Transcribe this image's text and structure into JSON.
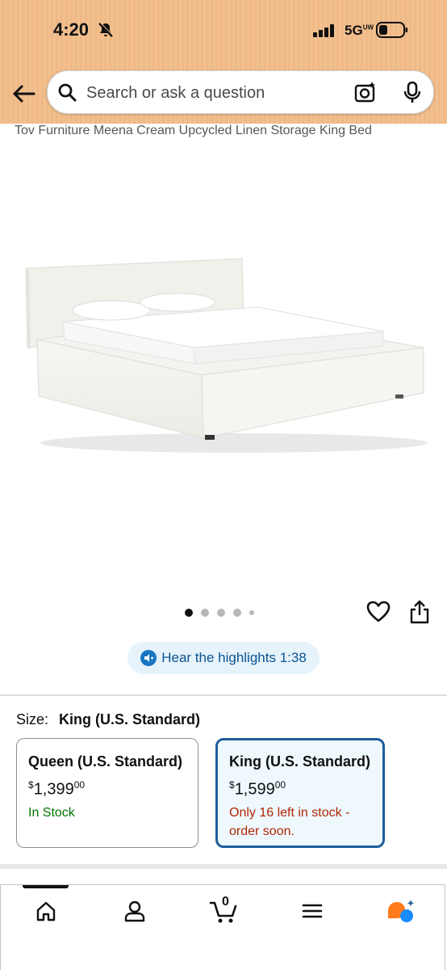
{
  "status_bar": {
    "time": "4:20",
    "network": "5G",
    "network_sup": "UW"
  },
  "search": {
    "placeholder": "Search or ask a question"
  },
  "product": {
    "title": "Tov Furniture Meena Cream Upcycled Linen Storage King Bed"
  },
  "carousel": {
    "dots": 5,
    "active_index": 0
  },
  "hear": {
    "text": "Hear the highlights 1:38"
  },
  "size": {
    "label": "Size:",
    "selected_value": "King (U.S. Standard)",
    "options": [
      {
        "name": "Queen (U.S. Standard)",
        "price_symbol": "$",
        "price_whole": "1,399",
        "price_cents": "00",
        "stock": "In Stock"
      },
      {
        "name": "King (U.S. Standard)",
        "price_symbol": "$",
        "price_whole": "1,599",
        "price_cents": "00",
        "stock": "Only 16 left in stock - order soon."
      }
    ]
  },
  "nav": {
    "cart_count": "0",
    "items": [
      "home-icon",
      "account-icon",
      "cart-icon",
      "menu-icon",
      "rufus-icon"
    ]
  },
  "colors": {
    "header_bg": "#f2c08f",
    "accent_blue": "#1f5e9c",
    "stock_green": "#007600",
    "stock_red": "#b12704"
  }
}
